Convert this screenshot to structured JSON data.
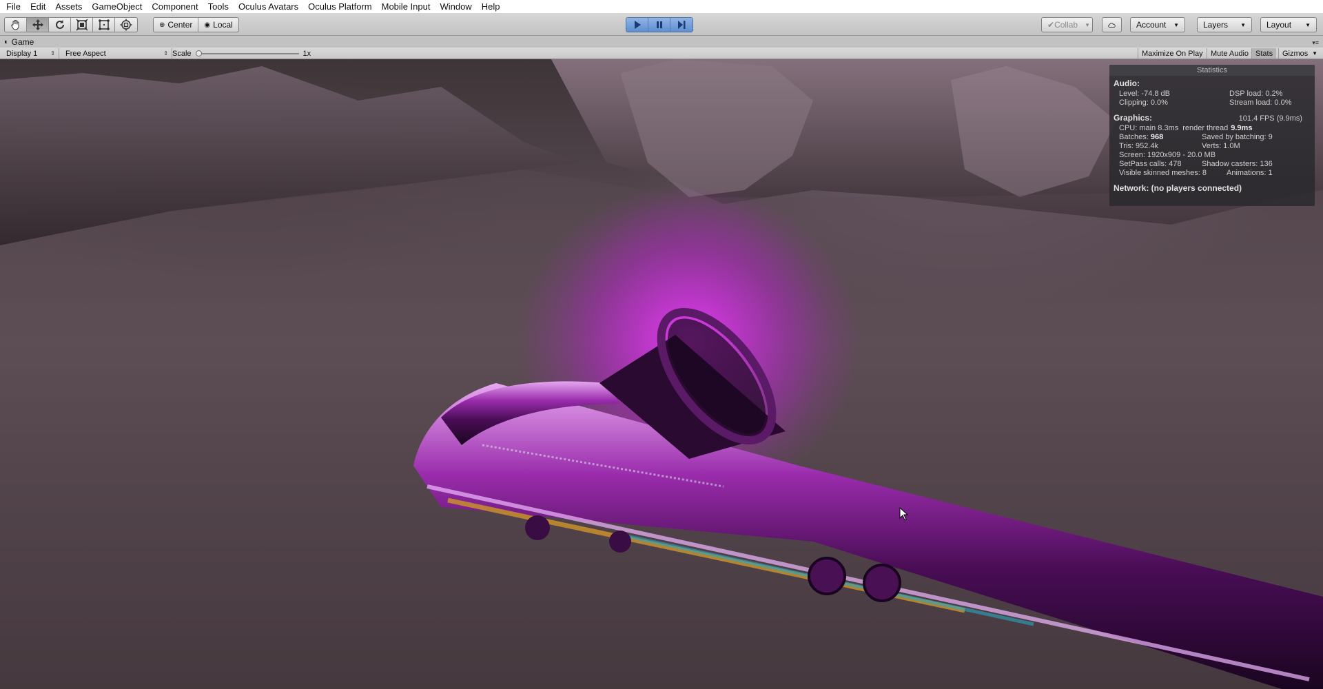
{
  "menu": [
    "File",
    "Edit",
    "Assets",
    "GameObject",
    "Component",
    "Tools",
    "Oculus Avatars",
    "Oculus Platform",
    "Mobile Input",
    "Window",
    "Help"
  ],
  "toolbar": {
    "pivot_center_label": "Center",
    "pivot_local_label": "Local",
    "collab_label": "Collab",
    "account_label": "Account",
    "layers_label": "Layers",
    "layout_label": "Layout",
    "tools": [
      "hand-icon",
      "move-icon",
      "rotate-icon",
      "scale-icon",
      "rect-icon",
      "transform-icon"
    ],
    "play_color": "#5f8fd0"
  },
  "game_tab": {
    "label": "Game"
  },
  "game_bar": {
    "display": "Display 1",
    "aspect": "Free Aspect",
    "scale_label": "Scale",
    "scale_value": "1x",
    "scale_level": 0,
    "maximize_on_play": "Maximize On Play",
    "mute_audio": "Mute Audio",
    "stats": "Stats",
    "gizmos": "Gizmos"
  },
  "statistics": {
    "title": "Statistics",
    "audio_heading": "Audio:",
    "level": "Level: -74.8 dB",
    "dsp_load": "DSP load: 0.2%",
    "clipping": "Clipping: 0.0%",
    "stream_load": "Stream load: 0.0%",
    "graphics_heading": "Graphics:",
    "fps": "101.4 FPS (9.9ms)",
    "cpu_main_label": "CPU: main 8.3ms",
    "render_thread_label": "render thread",
    "render_thread_value": "9.9ms",
    "batches_label": "Batches:",
    "batches_value": "968",
    "saved_by_batching": "Saved by batching: 9",
    "tris": "Tris: 952.4k",
    "verts": "Verts: 1.0M",
    "screen": "Screen: 1920x909 - 20.0 MB",
    "setpass": "SetPass calls: 478",
    "shadow_casters": "Shadow casters: 136",
    "skinned": "Visible skinned meshes: 8",
    "animations": "Animations: 1",
    "network": "Network: (no players connected)"
  },
  "colors": {
    "glow": "#dc28f0",
    "ground": "#5e4f56",
    "sax_purple": "#6a1a78",
    "sax_gold": "#c8902c",
    "sax_teal": "#2aa8c0"
  }
}
